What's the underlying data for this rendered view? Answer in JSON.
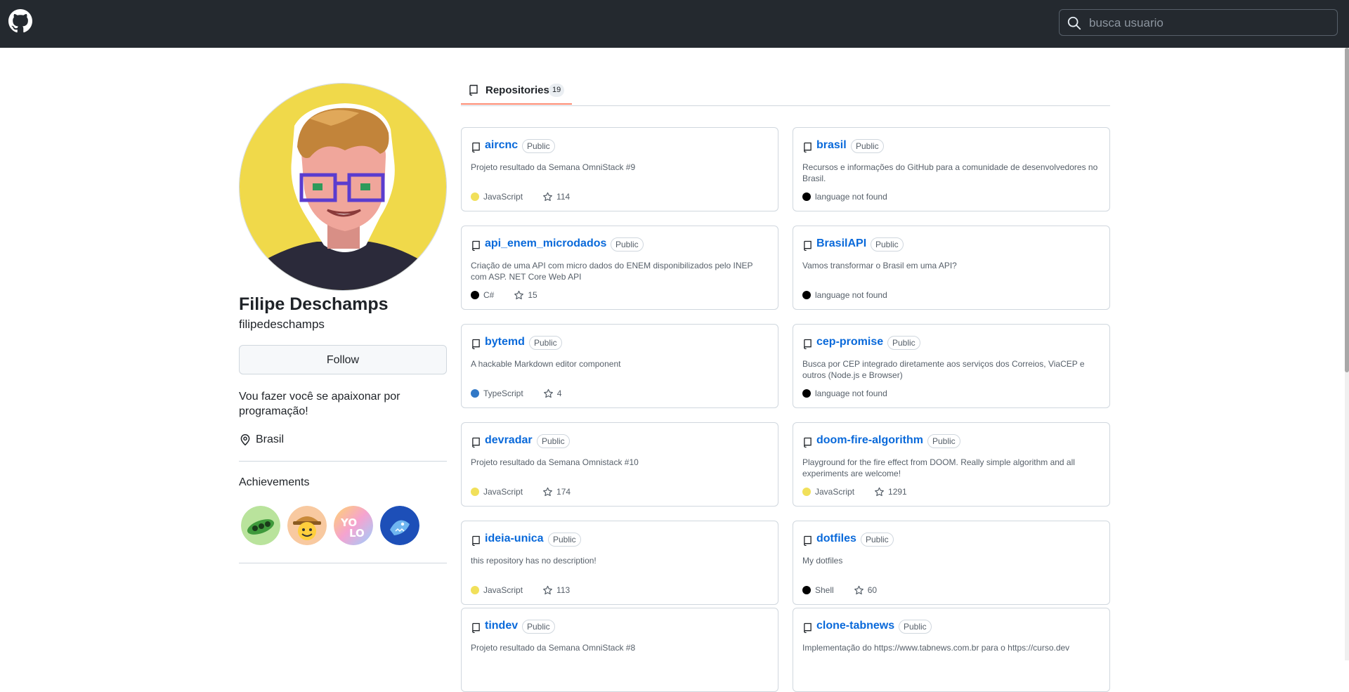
{
  "search": {
    "placeholder": "busca usuario"
  },
  "profile": {
    "name": "Filipe Deschamps",
    "login": "filipedeschamps",
    "follow_label": "Follow",
    "bio": "Vou fazer você se apaixonar por programação!",
    "location": "Brasil",
    "achievements_title": "Achievements"
  },
  "achievements": [
    {
      "icon": "peas-badge-icon"
    },
    {
      "icon": "cowboy-badge-icon"
    },
    {
      "icon": "yolo-badge-icon"
    },
    {
      "icon": "shark-badge-icon"
    }
  ],
  "tabs": [
    {
      "label": "Repositories",
      "count": "19",
      "icon": "repo-icon"
    }
  ],
  "colors": {
    "topbar": "#24292f",
    "link": "#0969da",
    "tab_underline": "#fd8c73",
    "javascript": "#f1e05a",
    "typescript": "#3178c6",
    "csharp": "#000000",
    "shell": "#000000",
    "unknown": "#000000"
  },
  "repos": [
    {
      "name": "aircnc",
      "visibility": "Public",
      "description": "Projeto resultado da Semana OmniStack #9",
      "language": "JavaScript",
      "lang_color": "#f1e05a",
      "stars": "114"
    },
    {
      "name": "brasil",
      "visibility": "Public",
      "description": "Recursos e informações do GitHub para a comunidade de desenvolvedores no Brasil.",
      "language": "language not found",
      "lang_color": "#000000",
      "stars": ""
    },
    {
      "name": "api_enem_microdados",
      "visibility": "Public",
      "description": "Criação de uma API com micro dados do ENEM disponibilizados pelo INEP com ASP. NET Core Web API",
      "language": "C#",
      "lang_color": "#000000",
      "stars": "15"
    },
    {
      "name": "BrasilAPI",
      "visibility": "Public",
      "description": "Vamos transformar o Brasil em uma API?",
      "language": "language not found",
      "lang_color": "#000000",
      "stars": ""
    },
    {
      "name": "bytemd",
      "visibility": "Public",
      "description": "A hackable Markdown editor component",
      "language": "TypeScript",
      "lang_color": "#3178c6",
      "stars": "4"
    },
    {
      "name": "cep-promise",
      "visibility": "Public",
      "description": "Busca por CEP integrado diretamente aos serviços dos Correios, ViaCEP e outros (Node.js e Browser)",
      "language": "language not found",
      "lang_color": "#000000",
      "stars": ""
    },
    {
      "name": "devradar",
      "visibility": "Public",
      "description": "Projeto resultado da Semana Omnistack #10",
      "language": "JavaScript",
      "lang_color": "#f1e05a",
      "stars": "174"
    },
    {
      "name": "doom-fire-algorithm",
      "visibility": "Public",
      "description": "Playground for the fire effect from DOOM. Really simple algorithm and all experiments are welcome!",
      "language": "JavaScript",
      "lang_color": "#f1e05a",
      "stars": "1291"
    },
    {
      "name": "ideia-unica",
      "visibility": "Public",
      "description": "this repository has no description!",
      "language": "JavaScript",
      "lang_color": "#f1e05a",
      "stars": "113"
    },
    {
      "name": "dotfiles",
      "visibility": "Public",
      "description": "My dotfiles",
      "language": "Shell",
      "lang_color": "#000000",
      "stars": "60"
    },
    {
      "name": "tindev",
      "visibility": "Public",
      "description": "Projeto resultado da Semana OmniStack #8",
      "language": "",
      "lang_color": "",
      "stars": ""
    },
    {
      "name": "clone-tabnews",
      "visibility": "Public",
      "description": "Implementação do https://www.tabnews.com.br para o https://curso.dev",
      "language": "",
      "lang_color": "",
      "stars": ""
    }
  ]
}
